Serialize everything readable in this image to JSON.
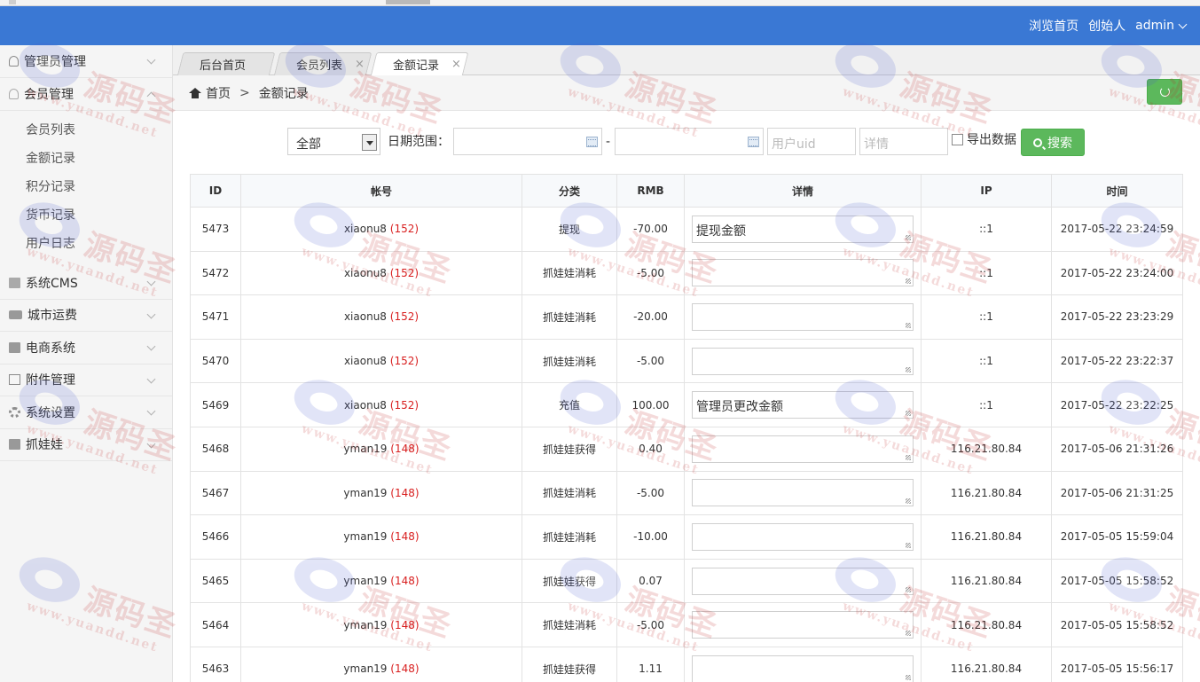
{
  "topbar": {
    "links": [
      "浏览首页",
      "创始人"
    ],
    "user": "admin"
  },
  "sidebar": {
    "items": [
      {
        "label": "管理员管理",
        "icon": "person-icon",
        "expanded": false
      },
      {
        "label": "会员管理",
        "icon": "user-icon",
        "expanded": true,
        "children": [
          "会员列表",
          "金额记录",
          "积分记录",
          "货币记录",
          "用户日志"
        ]
      },
      {
        "label": "系统CMS",
        "icon": "document-icon",
        "expanded": false
      },
      {
        "label": "城市运费",
        "icon": "truck-icon",
        "expanded": false
      },
      {
        "label": "电商系统",
        "icon": "card-icon",
        "expanded": false
      },
      {
        "label": "附件管理",
        "icon": "image-icon",
        "expanded": false
      },
      {
        "label": "系统设置",
        "icon": "gear-icon",
        "expanded": false
      },
      {
        "label": "抓娃娃",
        "icon": "card-icon",
        "expanded": false
      }
    ]
  },
  "tabs": [
    {
      "label": "后台首页",
      "closable": false,
      "active": false
    },
    {
      "label": "会员列表",
      "closable": true,
      "active": false
    },
    {
      "label": "金额记录",
      "closable": true,
      "active": true
    }
  ],
  "close_glyph": "×",
  "breadcrumb": {
    "home": "首页",
    "sep": ">",
    "current": "金额记录"
  },
  "filters": {
    "category_value": "全部",
    "date_label": "日期范围：",
    "date_sep": "-",
    "uid_placeholder": "用户uid",
    "detail_placeholder": "详情",
    "export_label": "导出数据",
    "search_label": "搜索"
  },
  "table": {
    "columns": [
      "ID",
      "帐号",
      "分类",
      "RMB",
      "详情",
      "IP",
      "时间"
    ],
    "rows": [
      {
        "id": "5473",
        "account": "xiaonu8",
        "uid": "(152)",
        "category": "提现",
        "rmb": "-70.00",
        "sign": "neg",
        "detail": "提现金额",
        "ip": "::1",
        "time": "2017-05-22 23:24:59"
      },
      {
        "id": "5472",
        "account": "xiaonu8",
        "uid": "(152)",
        "category": "抓娃娃消耗",
        "rmb": "-5.00",
        "sign": "neg",
        "detail": "",
        "ip": "::1",
        "time": "2017-05-22 23:24:00"
      },
      {
        "id": "5471",
        "account": "xiaonu8",
        "uid": "(152)",
        "category": "抓娃娃消耗",
        "rmb": "-20.00",
        "sign": "neg",
        "detail": "",
        "ip": "::1",
        "time": "2017-05-22 23:23:29"
      },
      {
        "id": "5470",
        "account": "xiaonu8",
        "uid": "(152)",
        "category": "抓娃娃消耗",
        "rmb": "-5.00",
        "sign": "neg",
        "detail": "",
        "ip": "::1",
        "time": "2017-05-22 23:22:37"
      },
      {
        "id": "5469",
        "account": "xiaonu8",
        "uid": "(152)",
        "category": "充值",
        "rmb": "100.00",
        "sign": "pos",
        "detail": "管理员更改金额",
        "ip": "::1",
        "time": "2017-05-22 23:22:25"
      },
      {
        "id": "5468",
        "account": "yman19",
        "uid": "(148)",
        "category": "抓娃娃获得",
        "rmb": "0.40",
        "sign": "pos",
        "detail": "",
        "ip": "116.21.80.84",
        "time": "2017-05-06 21:31:26"
      },
      {
        "id": "5467",
        "account": "yman19",
        "uid": "(148)",
        "category": "抓娃娃消耗",
        "rmb": "-5.00",
        "sign": "neg",
        "detail": "",
        "ip": "116.21.80.84",
        "time": "2017-05-06 21:31:25"
      },
      {
        "id": "5466",
        "account": "yman19",
        "uid": "(148)",
        "category": "抓娃娃消耗",
        "rmb": "-10.00",
        "sign": "neg",
        "detail": "",
        "ip": "116.21.80.84",
        "time": "2017-05-05 15:59:04"
      },
      {
        "id": "5465",
        "account": "yman19",
        "uid": "(148)",
        "category": "抓娃娃获得",
        "rmb": "0.07",
        "sign": "pos",
        "detail": "",
        "ip": "116.21.80.84",
        "time": "2017-05-05 15:58:52"
      },
      {
        "id": "5464",
        "account": "yman19",
        "uid": "(148)",
        "category": "抓娃娃消耗",
        "rmb": "-5.00",
        "sign": "neg",
        "detail": "",
        "ip": "116.21.80.84",
        "time": "2017-05-05 15:58:52"
      },
      {
        "id": "5463",
        "account": "yman19",
        "uid": "(148)",
        "category": "抓娃娃获得",
        "rmb": "1.11",
        "sign": "pos",
        "detail": "",
        "ip": "116.21.80.84",
        "time": "2017-05-05 15:56:17"
      }
    ]
  },
  "watermark": {
    "brand": "源码圣",
    "url": "www.yuandd.net"
  },
  "colors": {
    "header": "#3a78d4",
    "negative": "#d81e1e",
    "positive": "#1e8a1e",
    "button": "#5cb85c"
  }
}
